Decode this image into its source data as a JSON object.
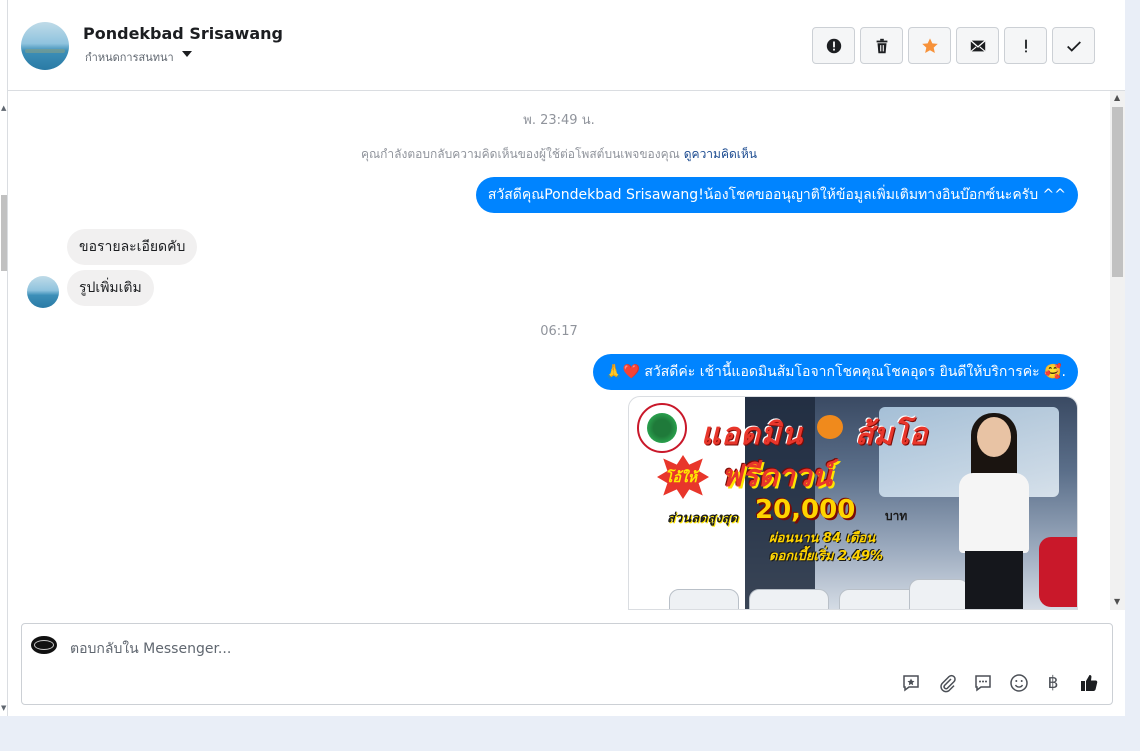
{
  "header": {
    "contact_name": "Pondekbad Srisawang",
    "assign_label": "กำหนดการสนทนา",
    "actions": [
      {
        "name": "report-button",
        "icon": "exclamation-circle-icon"
      },
      {
        "name": "delete-button",
        "icon": "trash-icon"
      },
      {
        "name": "star-button",
        "icon": "star-icon"
      },
      {
        "name": "mark-unread-button",
        "icon": "envelope-icon"
      },
      {
        "name": "important-button",
        "icon": "exclamation-icon"
      },
      {
        "name": "done-button",
        "icon": "check-icon"
      }
    ]
  },
  "conversation": {
    "timestamp_1": "พ. 23:49 น.",
    "notice_text": "คุณกำลังตอบกลับความคิดเห็นของผู้ใช้ต่อโพสต์บนเพจของคุณ",
    "notice_link": "ดูความคิดเห็น",
    "msg_out_1": "สวัสดีคุณPondekbad Srisawang!น้องโชคขออนุญาติให้ข้อมูลเพิ่มเติมทางอินบ๊อกซ์นะครับ ^^",
    "msg_in_1": "ขอรายละเอียดคับ",
    "msg_in_2": "รูปเพิ่มเติม",
    "timestamp_2": "06:17",
    "msg_out_2": "🙏❤️ สวัสดีค่ะ เช้านี้แอดมินส้มโอจากโชคคุณโชคอุดร ยินดีให้บริการค่ะ 🥰.",
    "promo_image": {
      "title_a": "แอดมิน",
      "title_b": "ส้มโอ",
      "burst": "โอ้ให้",
      "headline": "ฟรีดาวน์",
      "discount_label": "ส่วนลดสูงสุด",
      "discount_amount": "20,000",
      "discount_unit": "บาท",
      "installment": "ผ่อนนาน 84 เดือน",
      "interest": "ดอกเบี้ยเริ่ม 2.49%"
    }
  },
  "composer": {
    "placeholder": "ตอบกลับใน Messenger...",
    "tools": [
      "saved-reply-icon",
      "attachment-icon",
      "message-icon",
      "emoji-icon",
      "baht-icon",
      "thumbs-up-icon"
    ],
    "baht_symbol": "฿"
  },
  "colors": {
    "accent": "#0084ff",
    "incoming_bubble": "#f1f0f0",
    "star": "#f7923a"
  }
}
